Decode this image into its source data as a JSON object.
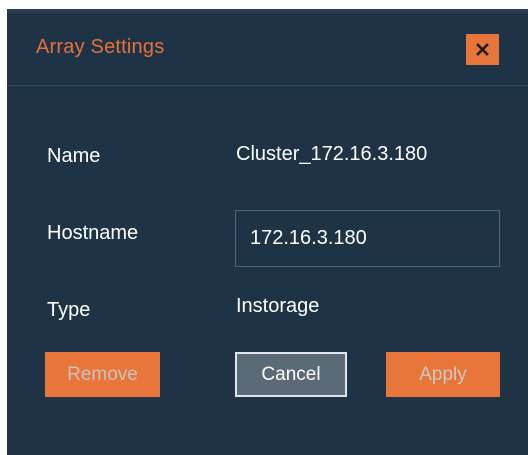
{
  "dialog": {
    "title": "Array Settings",
    "close_icon": "close-icon",
    "colors": {
      "background": "#1e3345",
      "accent": "#e8753a",
      "title": "#e8703a"
    }
  },
  "fields": {
    "name_label": "Name",
    "name_value": "Cluster_172.16.3.180",
    "hostname_label": "Hostname",
    "hostname_value": "172.16.3.180",
    "type_label": "Type",
    "type_value": "Instorage"
  },
  "buttons": {
    "remove_label": "Remove",
    "cancel_label": "Cancel",
    "apply_label": "Apply"
  }
}
